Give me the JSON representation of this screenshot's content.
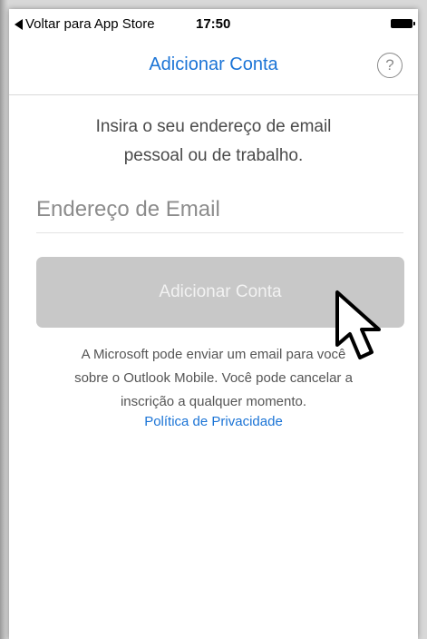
{
  "status_bar": {
    "back_label": "Voltar para App Store",
    "time": "17:50"
  },
  "nav": {
    "title": "Adicionar Conta",
    "help_symbol": "?"
  },
  "content": {
    "instruction_line1": "Insira o seu endereço de email",
    "instruction_line2": "pessoal ou de trabalho.",
    "email_placeholder": "Endereço de Email",
    "add_button_label": "Adicionar Conta",
    "disclaimer_line1": "A Microsoft pode enviar um email para você",
    "disclaimer_line2": "sobre o Outlook Mobile. Você pode cancelar a",
    "disclaimer_line3": "inscrição a qualquer momento.",
    "privacy_link": "Política de Privacidade"
  },
  "colors": {
    "accent": "#1b74d6",
    "button_disabled": "#c8c8c8"
  },
  "icons": {
    "back": "back-arrow-icon",
    "battery": "battery-icon",
    "help": "help-icon",
    "cursor": "mouse-cursor-icon"
  }
}
